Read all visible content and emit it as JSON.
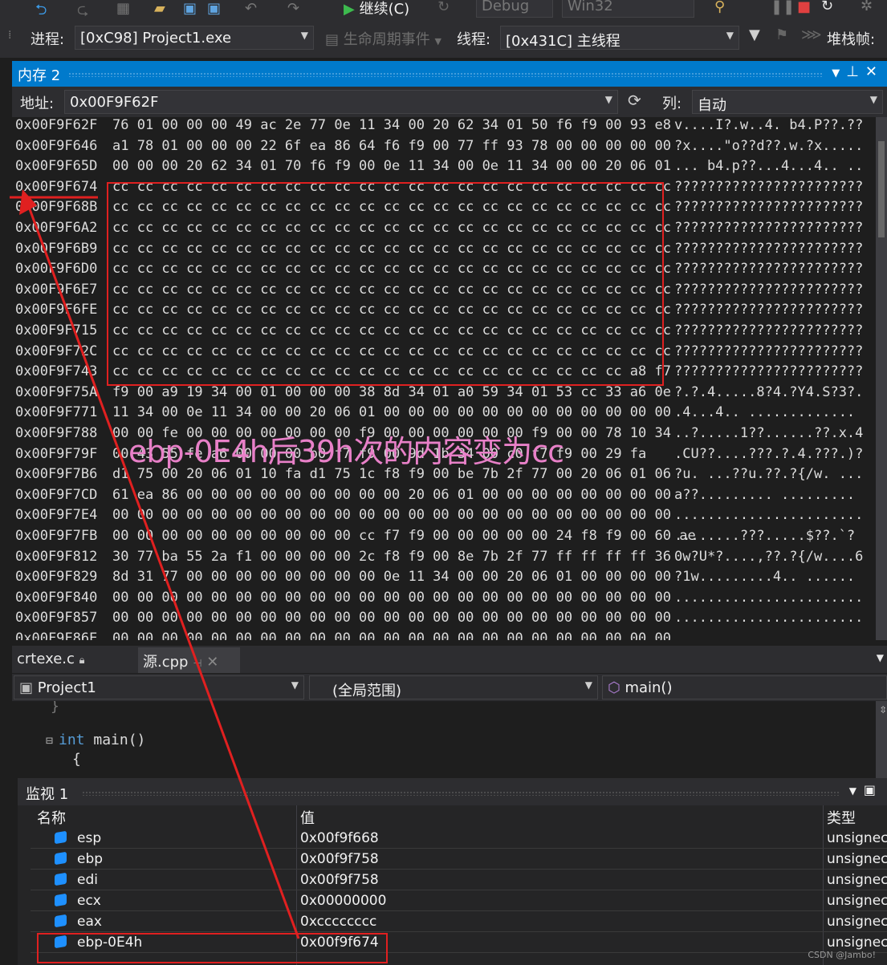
{
  "toolbar": {
    "continue_label": "继续(C)",
    "config": "Debug",
    "platform": "Win32"
  },
  "procbar": {
    "process_label": "进程:",
    "process_value": "[0xC98] Project1.exe",
    "lifecycle_label": "生命周期事件",
    "thread_label": "线程:",
    "thread_value": "[0x431C] 主线程",
    "stackframe_label": "堆栈帧:"
  },
  "memory": {
    "title": "内存 2",
    "address_label": "地址:",
    "address_value": "0x00F9F62F",
    "columns_label": "列:",
    "columns_value": "自动",
    "rows": [
      {
        "addr": "0x00F9F62F",
        "hex": "76 01 00 00 00 49 ac 2e 77 0e 11 34 00 20 62 34 01 50 f6 f9 00 93 e8",
        "ascii": "v....I?.w..4. b4.P??.??"
      },
      {
        "addr": "0x00F9F646",
        "hex": "a1 78 01 00 00 00 22 6f ea 86 64 f6 f9 00 77 ff 93 78 00 00 00 00 00",
        "ascii": "?x....\"o??d??.w.?x....."
      },
      {
        "addr": "0x00F9F65D",
        "hex": "00 00 00 20 62 34 01 70 f6 f9 00 0e 11 34 00 0e 11 34 00 00 20 06 01",
        "ascii": "... b4.p??...4...4.. .."
      },
      {
        "addr": "0x00F9F674",
        "hex": "cc cc cc cc cc cc cc cc cc cc cc cc cc cc cc cc cc cc cc cc cc cc cc",
        "ascii": "???????????????????????"
      },
      {
        "addr": "0x00F9F68B",
        "hex": "cc cc cc cc cc cc cc cc cc cc cc cc cc cc cc cc cc cc cc cc cc cc cc",
        "ascii": "???????????????????????"
      },
      {
        "addr": "0x00F9F6A2",
        "hex": "cc cc cc cc cc cc cc cc cc cc cc cc cc cc cc cc cc cc cc cc cc cc cc",
        "ascii": "???????????????????????"
      },
      {
        "addr": "0x00F9F6B9",
        "hex": "cc cc cc cc cc cc cc cc cc cc cc cc cc cc cc cc cc cc cc cc cc cc cc",
        "ascii": "???????????????????????"
      },
      {
        "addr": "0x00F9F6D0",
        "hex": "cc cc cc cc cc cc cc cc cc cc cc cc cc cc cc cc cc cc cc cc cc cc cc",
        "ascii": "???????????????????????"
      },
      {
        "addr": "0x00F9F6E7",
        "hex": "cc cc cc cc cc cc cc cc cc cc cc cc cc cc cc cc cc cc cc cc cc cc cc",
        "ascii": "???????????????????????"
      },
      {
        "addr": "0x00F9F6FE",
        "hex": "cc cc cc cc cc cc cc cc cc cc cc cc cc cc cc cc cc cc cc cc cc cc cc",
        "ascii": "???????????????????????"
      },
      {
        "addr": "0x00F9F715",
        "hex": "cc cc cc cc cc cc cc cc cc cc cc cc cc cc cc cc cc cc cc cc cc cc cc",
        "ascii": "???????????????????????"
      },
      {
        "addr": "0x00F9F72C",
        "hex": "cc cc cc cc cc cc cc cc cc cc cc cc cc cc cc cc cc cc cc cc cc cc cc",
        "ascii": "???????????????????????"
      },
      {
        "addr": "0x00F9F743",
        "hex": "cc cc cc cc cc cc cc cc cc cc cc cc cc cc cc cc cc cc cc cc cc a8 f7",
        "ascii": "???????????????????????"
      },
      {
        "addr": "0x00F9F75A",
        "hex": "f9 00 a9 19 34 00 01 00 00 00 38 8d 34 01 a0 59 34 01 53 cc 33 a6 0e",
        "ascii": "?.?.4.....8?4.?Y4.S?3?."
      },
      {
        "addr": "0x00F9F771",
        "hex": "11 34 00 0e 11 34 00 00 20 06 01 00 00 00 00 00 00 00 00 00 00 00 00",
        "ascii": ".4...4.. ............."
      },
      {
        "addr": "0x00F9F788",
        "hex": "00 00 fe 00 00 00 00 00 00 00 f9 00 00 00 00 00 00 f9 00 00 78 10 34",
        "ascii": "..?.....1??......??.x.4"
      },
      {
        "addr": "0x00F9F79F",
        "hex": "00 43 55 fe a6 00 00 00 b0 f7 f9 00 9d 1b 34 00 c0 f7 f9 00 29 fa",
        "ascii": ".CU??....???.?.4.???.)?"
      },
      {
        "addr": "0x00F9F7B6",
        "hex": "d1 75 00 20 06 01 10 fa d1 75 1c f8 f9 00 be 7b 2f 77 00 20 06 01 06",
        "ascii": "?u. ...??u.??.?{/w. ..."
      },
      {
        "addr": "0x00F9F7CD",
        "hex": "61 ea 86 00 00 00 00 00 00 00 00 00 20 06 01 00 00 00 00 00 00 00 00",
        "ascii": "a??......... ........."
      },
      {
        "addr": "0x00F9F7E4",
        "hex": "00 00 00 00 00 00 00 00 00 00 00 00 00 00 00 00 00 00 00 00 00 00 00",
        "ascii": "......................."
      },
      {
        "addr": "0x00F9F7FB",
        "hex": "00 00 00 00 00 00 00 00 00 00 cc f7 f9 00 00 00 00 00 24 f8 f9 00 60 ae",
        "ascii": "........???.....$??.`?"
      },
      {
        "addr": "0x00F9F812",
        "hex": "30 77 ba 55 2a f1 00 00 00 00 2c f8 f9 00 8e 7b 2f 77 ff ff ff ff 36",
        "ascii": "0w?U*?....,??.?{/w....6"
      },
      {
        "addr": "0x00F9F829",
        "hex": "8d 31 77 00 00 00 00 00 00 00 00 0e 11 34 00 00 20 06 01 00 00 00 00",
        "ascii": "?1w.........4.. ......"
      },
      {
        "addr": "0x00F9F840",
        "hex": "00 00 00 00 00 00 00 00 00 00 00 00 00 00 00 00 00 00 00 00 00 00 00",
        "ascii": "......................."
      },
      {
        "addr": "0x00F9F857",
        "hex": "00 00 00 00 00 00 00 00 00 00 00 00 00 00 00 00 00 00 00 00 00 00 00",
        "ascii": "......................."
      },
      {
        "addr": "0x00F9F86E",
        "hex": "00 00 00 00 00 00 00 00 00 00 00 00 00 00 00 00 00 00 00 00 00 00 00",
        "ascii": ""
      }
    ]
  },
  "annotation": "ebp-0E4h后39h次的内容变为cc",
  "tabs": [
    {
      "label": "crtexe.c"
    },
    {
      "label": "源.cpp"
    }
  ],
  "nav": {
    "project": "Project1",
    "scope": "(全局范围)",
    "function": "main()"
  },
  "code": {
    "line0": "}",
    "line1_kw": "int",
    "line1_rest": " main()",
    "line2": "{"
  },
  "watch": {
    "title": "监视 1",
    "col_name": "名称",
    "col_value": "值",
    "col_type": "类型",
    "rows": [
      {
        "name": "esp",
        "value": "0x00f9f668",
        "type": "unsignec"
      },
      {
        "name": "ebp",
        "value": "0x00f9f758",
        "type": "unsignec"
      },
      {
        "name": "edi",
        "value": "0x00f9f758",
        "type": "unsignec"
      },
      {
        "name": "ecx",
        "value": "0x00000000",
        "type": "unsignec"
      },
      {
        "name": "eax",
        "value": "0xcccccccc",
        "type": "unsignec"
      },
      {
        "name": "ebp-0E4h",
        "value": "0x00f9f674",
        "type": "unsignec"
      }
    ]
  },
  "watermark": "CSDN @Jambo!"
}
